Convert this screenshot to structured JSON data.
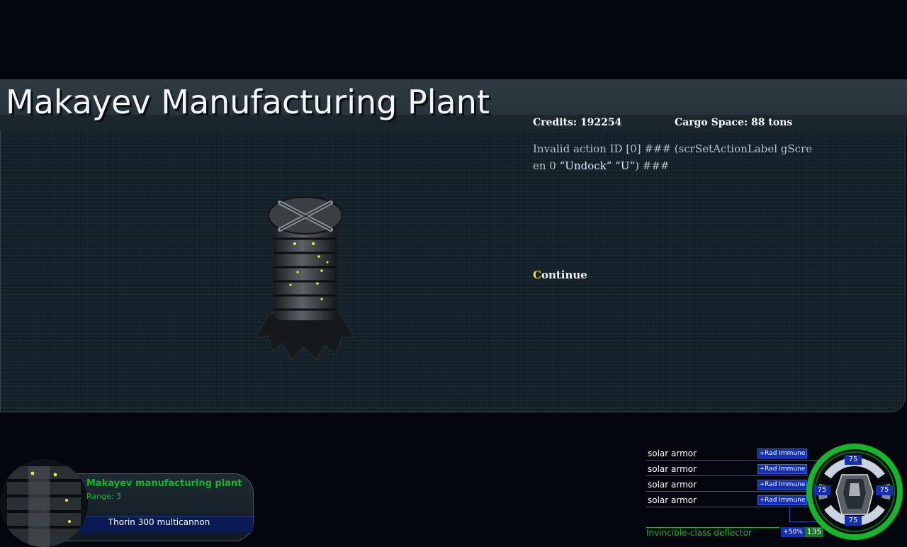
{
  "screen": {
    "title": "Makayev Manufacturing Plant",
    "credits_label": "Credits:",
    "credits_value": "192254",
    "cargo_label": "Cargo Space:",
    "cargo_value": "88 tons",
    "description_line1": "Invalid action ID [0] ### (scrSetActionLabel gScreen 0",
    "description_line2a": "“Undock” “U”",
    "description_line2b": ") ###",
    "action": {
      "key": "C",
      "rest": "ontinue"
    }
  },
  "target": {
    "name": "Makayev manufacturing plant",
    "range": "Range: 3",
    "weapon": "Thorin 300 multicannon"
  },
  "armor": {
    "segments": [
      {
        "name": "solar armor",
        "mod": "+Rad Immune"
      },
      {
        "name": "solar armor",
        "mod": "+Rad Immune"
      },
      {
        "name": "solar armor",
        "mod": "+Rad Immune"
      },
      {
        "name": "solar armor",
        "mod": "+Rad Immune"
      }
    ],
    "values": {
      "top": "75",
      "left": "75",
      "right": "75",
      "bottom": "75"
    },
    "shield": {
      "name": "Invincible-class deflector",
      "mod": "+50%",
      "value": "135",
      "level": 1.0
    }
  },
  "colors": {
    "hud_green": "#16b52a",
    "hud_blue": "#1330b0",
    "accent_key": "#f2df1e",
    "background": "#03060d"
  }
}
